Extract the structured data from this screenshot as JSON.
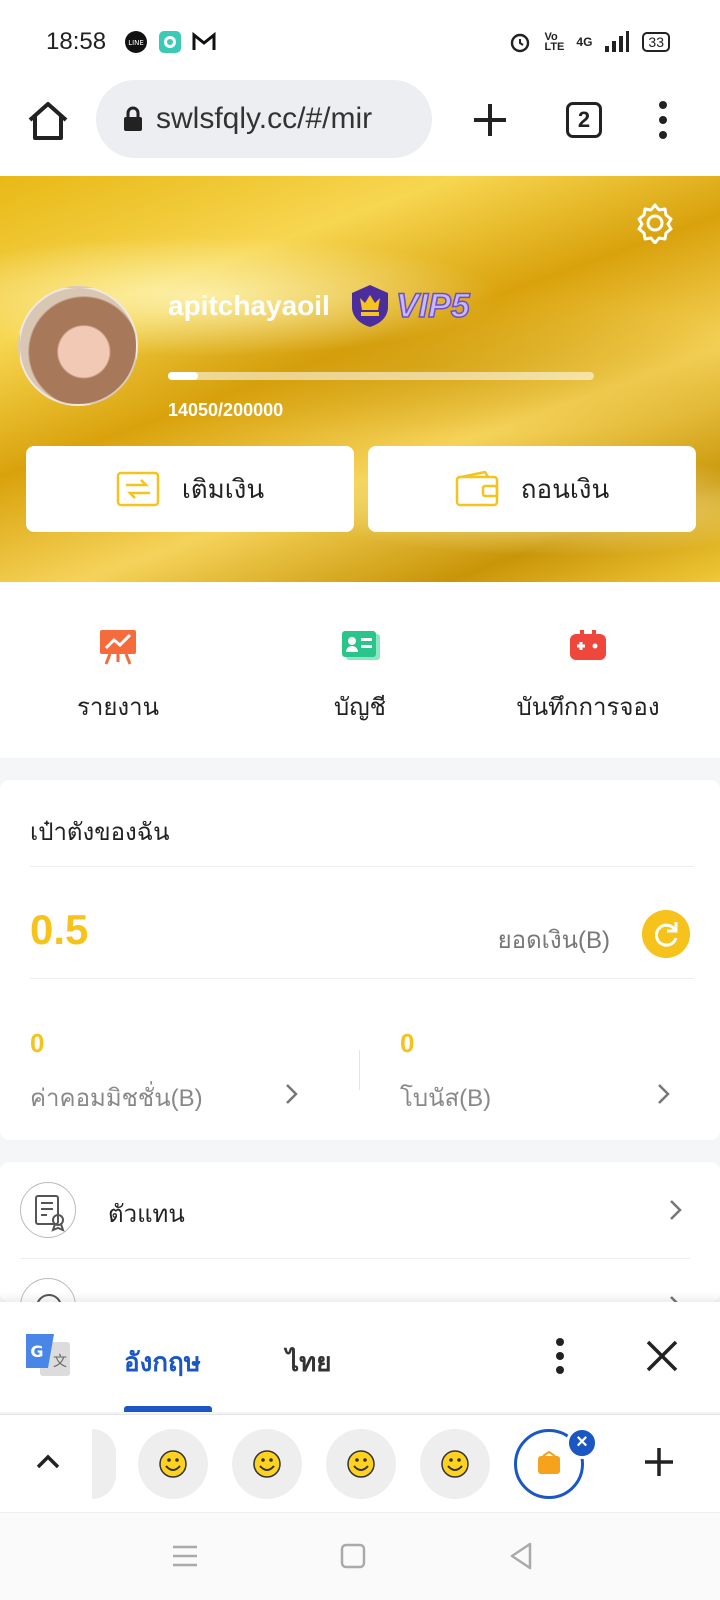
{
  "status_bar": {
    "time": "18:58",
    "battery": "33",
    "network": "4G",
    "left_icons": [
      "line-icon",
      "chat-bubble-icon",
      "gmail-icon"
    ],
    "right_icons": [
      "alarm-icon",
      "volte-icon",
      "signal-icon",
      "battery-icon"
    ]
  },
  "browser": {
    "url": "swlsfqly.cc/#/mir",
    "tab_count": "2",
    "icons": [
      "home-icon",
      "lock-icon",
      "plus-icon",
      "tabs-icon",
      "more-vert-icon"
    ]
  },
  "profile": {
    "username": "apitchayaoil",
    "vip_level": "VIP5",
    "progress_text": "14050/200000",
    "progress_fraction": 0.07025,
    "deposit_label": "เติมเงิน",
    "withdraw_label": "ถอนเงิน"
  },
  "quick_nav": [
    {
      "label": "รายงาน",
      "icon": "report-chart-icon"
    },
    {
      "label": "บัญชี",
      "icon": "account-card-icon"
    },
    {
      "label": "บันทึกการจอง",
      "icon": "game-controller-icon"
    }
  ],
  "wallet": {
    "title": "เป๋าตังของฉัน",
    "balance": "0.5",
    "balance_label": "ยอดเงิน(B)",
    "commission_value": "0",
    "commission_label": "ค่าคอมมิชชั่น(B)",
    "bonus_value": "0",
    "bonus_label": "โบนัส(B)"
  },
  "menu": {
    "items": [
      {
        "label": "ตัวแทน",
        "icon": "agent-document-icon"
      }
    ]
  },
  "translate_bar": {
    "source_lang": "อังกฤษ",
    "target_lang": "ไทย"
  },
  "colors": {
    "accent_gold": "#f6c21c",
    "translate_blue": "#1a56c4"
  }
}
